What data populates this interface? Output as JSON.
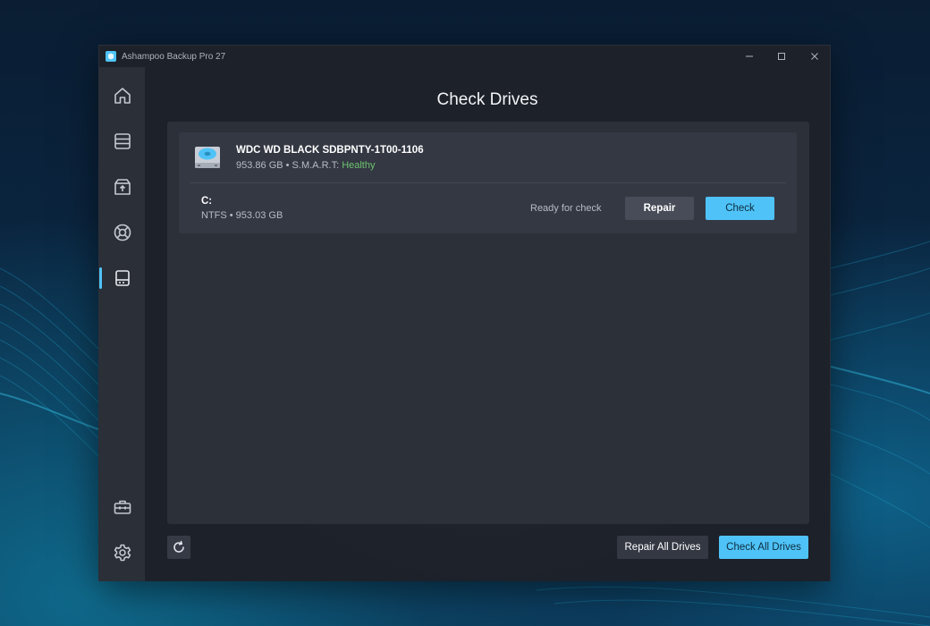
{
  "window": {
    "title": "Ashampoo Backup Pro 27"
  },
  "sidebar": {
    "items": [
      {
        "name": "home",
        "icon": "home-icon"
      },
      {
        "name": "backups",
        "icon": "server-stack-icon"
      },
      {
        "name": "restore",
        "icon": "box-upload-icon"
      },
      {
        "name": "rescue",
        "icon": "lifebuoy-icon"
      },
      {
        "name": "check-drives",
        "icon": "drive-icon",
        "active": true
      },
      {
        "name": "tools",
        "icon": "toolbox-icon"
      },
      {
        "name": "settings",
        "icon": "gear-icon"
      }
    ]
  },
  "main": {
    "title": "Check Drives",
    "drive": {
      "name": "WDC WD BLACK SDBPNTY-1T00-1106",
      "size_prefix": "953.86 GB • S.M.A.R.T: ",
      "smart_status": "Healthy",
      "partition": {
        "letter": "C:",
        "info": "NTFS • 953.03 GB",
        "status": "Ready for check",
        "repair_label": "Repair",
        "check_label": "Check"
      }
    },
    "footer": {
      "repair_all_label": "Repair All Drives",
      "check_all_label": "Check All Drives"
    }
  },
  "colors": {
    "accent": "#4fc3f7",
    "healthy": "#6cc36f",
    "window_bg": "#1d2129",
    "sidebar_bg": "#2b2f37"
  }
}
